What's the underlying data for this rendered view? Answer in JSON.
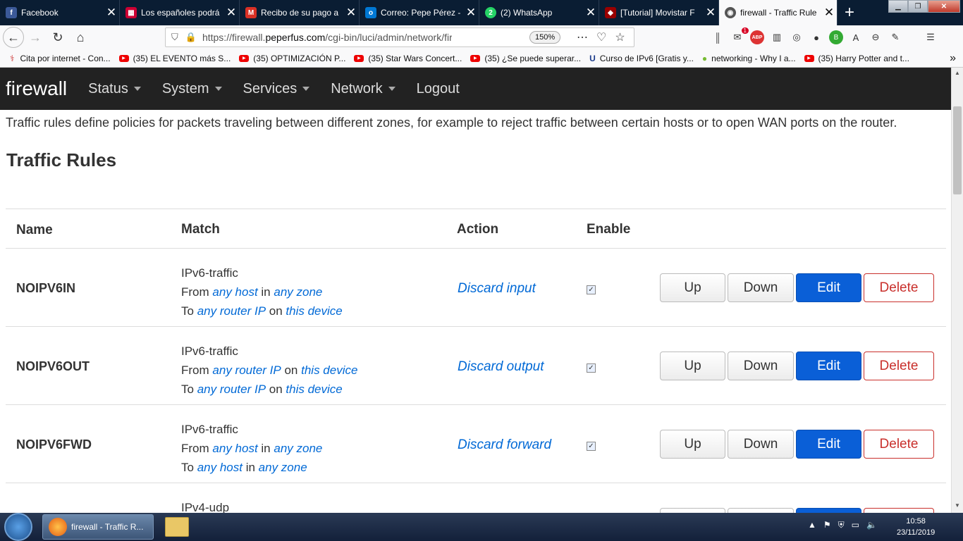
{
  "browser": {
    "tabs": [
      {
        "label": "Facebook",
        "icon": "facebook-icon",
        "color": "#3b5998"
      },
      {
        "label": "Los españoles podrá",
        "icon": "news-icon",
        "color": "#c03"
      },
      {
        "label": "Recibo de su pago a",
        "icon": "gmail-icon",
        "color": "#d93025"
      },
      {
        "label": "Correo: Pepe Pérez -",
        "icon": "outlook-icon",
        "color": "#0078d4"
      },
      {
        "label": "(2) WhatsApp",
        "icon": "whatsapp-icon",
        "color": "#25d366"
      },
      {
        "label": "[Tutorial] Movistar F",
        "icon": "shield-icon",
        "color": "#900"
      },
      {
        "label": "firewall - Traffic Rule",
        "icon": "openwrt-icon",
        "color": "#555"
      }
    ],
    "url_prefix": "https://firewall.",
    "url_host": "peperfus.com",
    "url_path": "/cgi-bin/luci/admin/network/firewall/rule",
    "zoom": "150%",
    "notification_count": "1",
    "abp_label": "ABP",
    "bookmarks": [
      "Cita por internet - Con...",
      "(35) EL EVENTO más S...",
      "(35) OPTIMIZACIÓN P...",
      "(35) Star Wars Concert...",
      "(35) ¿Se puede superar...",
      "Curso de IPv6 [Gratis y...",
      "networking - Why I a...",
      "(35) Harry Potter and t..."
    ]
  },
  "app": {
    "brand": "firewall",
    "menu": [
      "Status",
      "System",
      "Services",
      "Network",
      "Logout"
    ],
    "description": "Traffic rules define policies for packets traveling between different zones, for example to reject traffic between certain hosts or to open WAN ports on the router.",
    "section_title": "Traffic Rules",
    "columns": {
      "name": "Name",
      "match": "Match",
      "action": "Action",
      "enable": "Enable"
    },
    "buttons": {
      "up": "Up",
      "down": "Down",
      "edit": "Edit",
      "delete": "Delete"
    },
    "words": {
      "from": "From",
      "to": "To",
      "in": "in",
      "on": "on"
    },
    "rules": [
      {
        "name": "NOIPV6IN",
        "proto": "IPv6-traffic",
        "from_a": "any host",
        "from_sep": "in",
        "from_b": "any zone",
        "to_a": "any router IP",
        "to_sep": "on",
        "to_b": "this device",
        "action": "Discard input",
        "enabled": true
      },
      {
        "name": "NOIPV6OUT",
        "proto": "IPv6-traffic",
        "from_a": "any router IP",
        "from_sep": "on",
        "from_b": "this device",
        "to_a": "any router IP",
        "to_sep": "on",
        "to_b": "this device",
        "action": "Discard output",
        "enabled": true
      },
      {
        "name": "NOIPV6FWD",
        "proto": "IPv6-traffic",
        "from_a": "any host",
        "from_sep": "in",
        "from_b": "any zone",
        "to_a": "any host",
        "to_sep": "in",
        "to_b": "any zone",
        "action": "Discard forward",
        "enabled": true
      },
      {
        "name": "",
        "proto": "IPv4-udp"
      }
    ]
  },
  "taskbar": {
    "window_label": "firewall - Traffic R...",
    "time": "10:58",
    "date": "23/11/2019"
  }
}
